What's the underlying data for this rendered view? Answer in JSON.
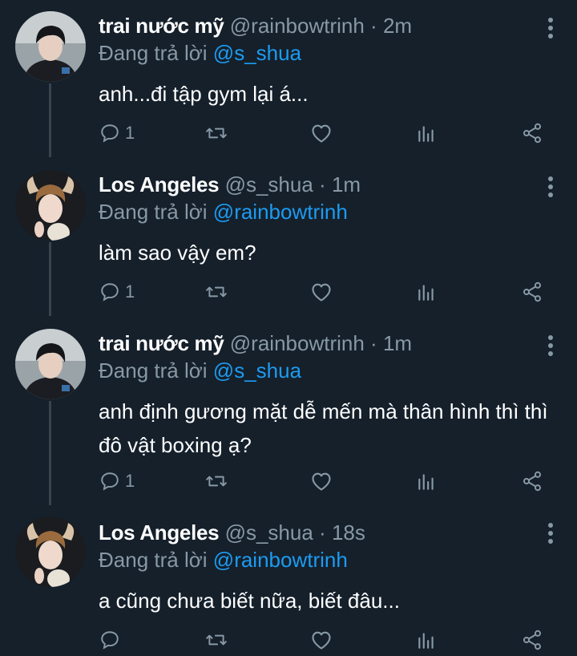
{
  "colors": {
    "background": "#15202b",
    "text_primary": "#ffffff",
    "text_secondary": "#8899a6",
    "mention": "#1d9bf0",
    "thread_line": "#38444d"
  },
  "replying_prefix": "Đang trả lời",
  "tweets": [
    {
      "name": "trai nước mỹ",
      "handle": "@rainbowtrinh",
      "dot": "·",
      "time": "2m",
      "replying_to": "@s_shua",
      "text": "anh...đi tập gym lại á...",
      "reply_count": "1",
      "avatar_icon": "dark-haired-man-avatar"
    },
    {
      "name": "Los Angeles",
      "handle": "@s_shua",
      "dot": "·",
      "time": "1m",
      "replying_to": "@rainbowtrinh",
      "text": "làm sao vậy em?",
      "reply_count": "1",
      "avatar_icon": "deer-ears-man-avatar"
    },
    {
      "name": "trai nước mỹ",
      "handle": "@rainbowtrinh",
      "dot": "·",
      "time": "1m",
      "replying_to": "@s_shua",
      "text": "anh định gương mặt dễ mến mà thân hình thì thì đô vật boxing ạ?",
      "reply_count": "1",
      "avatar_icon": "dark-haired-man-avatar"
    },
    {
      "name": "Los Angeles",
      "handle": "@s_shua",
      "dot": "·",
      "time": "18s",
      "replying_to": "@rainbowtrinh",
      "text": "a cũng chưa biết nữa, biết đâu...",
      "reply_count": "",
      "avatar_icon": "deer-ears-man-avatar"
    }
  ],
  "action_icons": [
    "reply-icon",
    "retweet-icon",
    "like-icon",
    "analytics-icon",
    "share-icon"
  ]
}
